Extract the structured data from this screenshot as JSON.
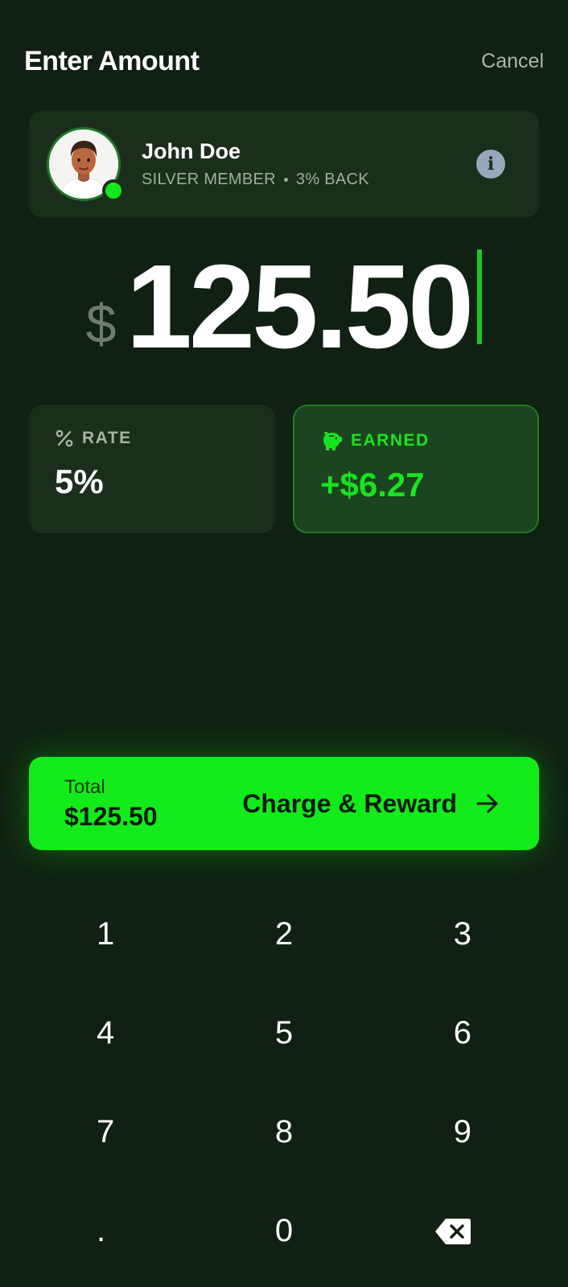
{
  "header": {
    "title": "Enter Amount",
    "cancel_label": "Cancel"
  },
  "customer": {
    "name": "John Doe",
    "tier": "SILVER MEMBER",
    "cashback": "3% BACK",
    "status": "online",
    "info_icon": "info-icon"
  },
  "amount": {
    "currency": "$",
    "value": "125.50"
  },
  "stats": {
    "rate": {
      "label": "RATE",
      "value": "5%",
      "icon": "percent-icon"
    },
    "earned": {
      "label": "EARNED",
      "value": "+$6.27",
      "icon": "piggy-bank-icon"
    }
  },
  "charge": {
    "total_label": "Total",
    "total_value": "$125.50",
    "action_label": "Charge & Reward",
    "action_icon": "arrow-right-icon"
  },
  "keypad": {
    "keys": [
      "1",
      "2",
      "3",
      "4",
      "5",
      "6",
      "7",
      "8",
      "9",
      ".",
      "0"
    ],
    "backspace_icon": "backspace-icon"
  },
  "colors": {
    "background": "#102012",
    "card": "#1b2e1c",
    "accent": "#13ec1a",
    "muted_text": "#9db09c"
  }
}
